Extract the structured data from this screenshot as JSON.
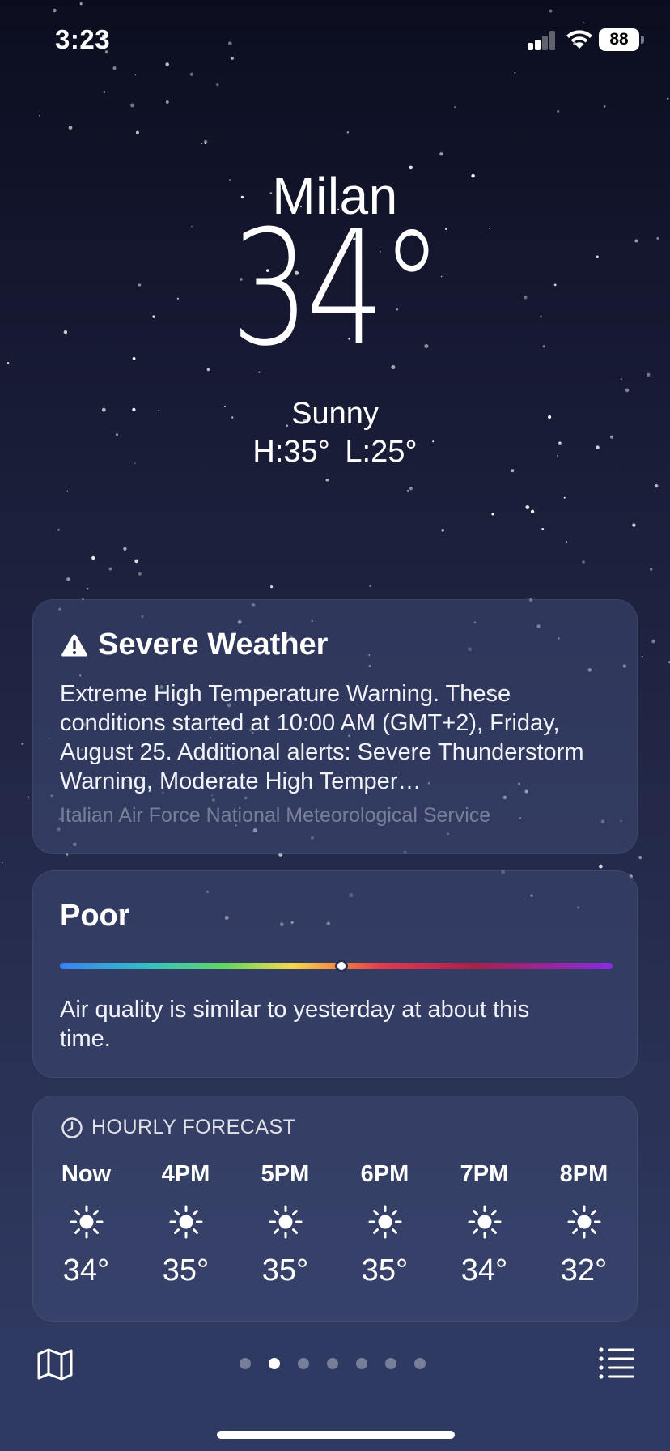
{
  "status_bar": {
    "time": "3:23",
    "battery": "88"
  },
  "hero": {
    "city": "Milan",
    "temperature": "34°",
    "condition": "Sunny",
    "high_low": "H:35°  L:25°"
  },
  "alert": {
    "icon": "warning-triangle-icon",
    "title": "Severe Weather",
    "text": "Extreme High Temperature Warning. These conditions started at 10:00 AM (GMT+2), Friday, August 25. Additional alerts: Severe Thunderstorm Warning, Moderate High Temper…",
    "source": "Italian Air Force National Meteorological Service"
  },
  "air_quality": {
    "label": "Poor",
    "level_fraction": 0.51,
    "description": "Air quality is similar to yesterday at about this time."
  },
  "hourly": {
    "header": "HOURLY FORECAST",
    "icon": "clock-icon",
    "hours": [
      {
        "label": "Now",
        "icon": "sun-icon",
        "temp": "34°"
      },
      {
        "label": "4PM",
        "icon": "sun-icon",
        "temp": "35°"
      },
      {
        "label": "5PM",
        "icon": "sun-icon",
        "temp": "35°"
      },
      {
        "label": "6PM",
        "icon": "sun-icon",
        "temp": "35°"
      },
      {
        "label": "7PM",
        "icon": "sun-icon",
        "temp": "34°"
      },
      {
        "label": "8PM",
        "icon": "sun-icon",
        "temp": "32°"
      }
    ]
  },
  "bottom_bar": {
    "page_count": 7,
    "active_page": 1
  },
  "colors": {
    "background_top": "#0b0d1f",
    "background_bottom": "#323d66",
    "card": "#3e4873"
  }
}
